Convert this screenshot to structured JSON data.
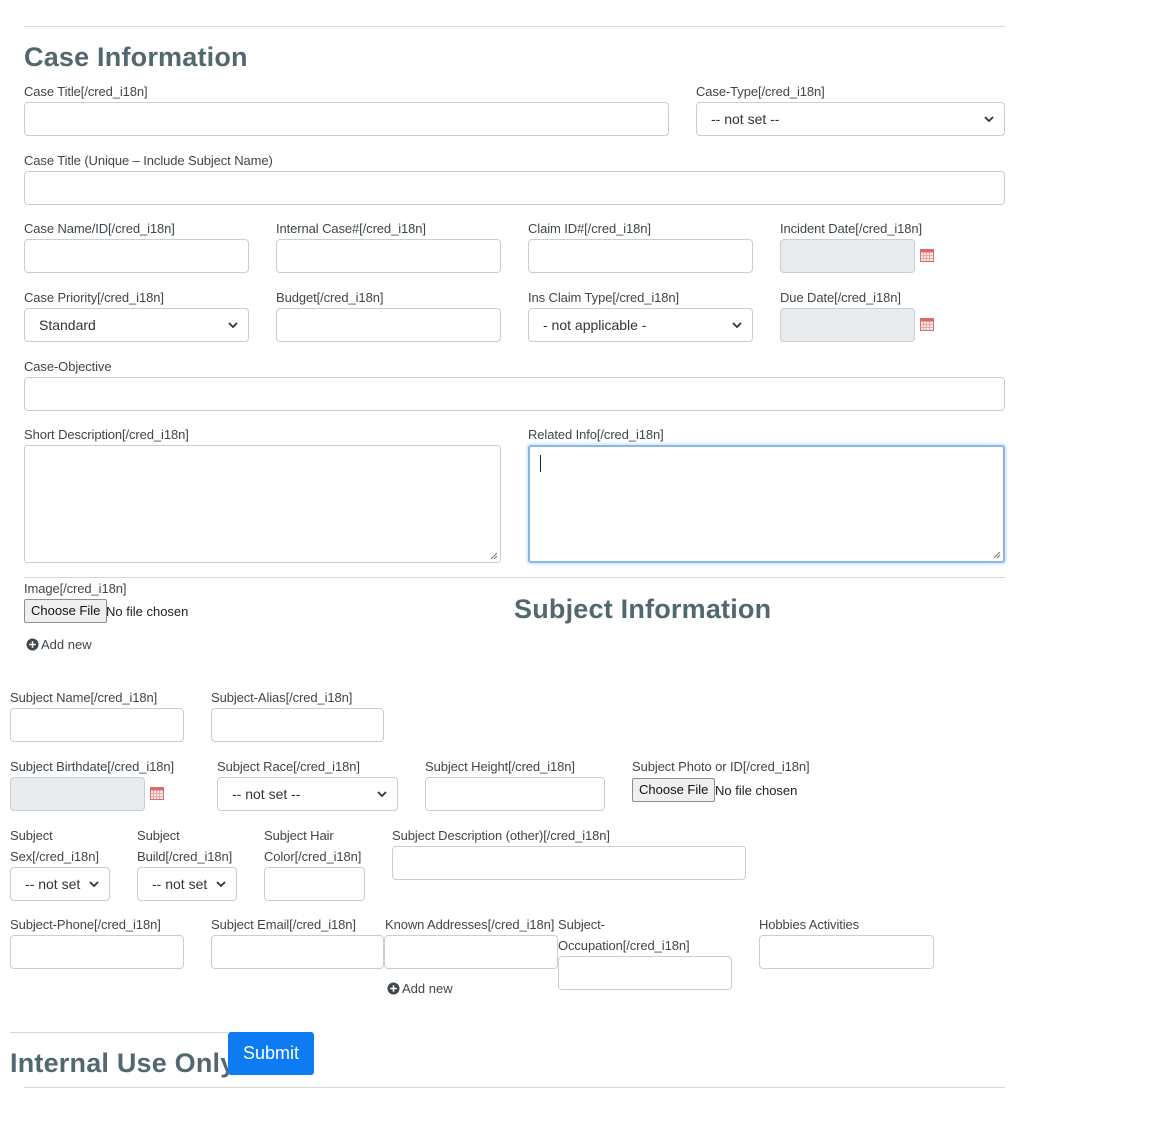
{
  "case_section": {
    "title": "Case Information",
    "case_title_label": "Case Title[/cred_i18n]",
    "case_type_label": "Case-Type[/cred_i18n]",
    "case_type_value": "-- not set --",
    "case_title_unique_label": "Case Title (Unique – Include Subject Name)",
    "case_name_label": "Case Name/ID[/cred_i18n]",
    "internal_case_label": "Internal Case#[/cred_i18n]",
    "claim_id_label": "Claim ID#[/cred_i18n]",
    "incident_date_label": "Incident Date[/cred_i18n]",
    "case_priority_label": "Case Priority[/cred_i18n]",
    "case_priority_value": "Standard",
    "budget_label": "Budget[/cred_i18n]",
    "ins_claim_type_label": "Ins Claim Type[/cred_i18n]",
    "ins_claim_type_value": "- not applicable -",
    "due_date_label": "Due Date[/cred_i18n]",
    "case_objective_label": "Case-Objective",
    "short_description_label": "Short Description[/cred_i18n]",
    "related_info_label": "Related Info[/cred_i18n]",
    "image_label": "Image[/cred_i18n]",
    "choose_file": "Choose File",
    "no_file": "No file chosen",
    "add_new": "Add new"
  },
  "subject_section": {
    "title": "Subject Information",
    "subject_name_label": "Subject Name[/cred_i18n]",
    "subject_alias_label": "Subject-Alias[/cred_i18n]",
    "birthdate_label": "Subject Birthdate[/cred_i18n]",
    "race_label": "Subject Race[/cred_i18n]",
    "race_value": "-- not set --",
    "height_label": "Subject Height[/cred_i18n]",
    "photo_label": "Subject Photo or ID[/cred_i18n]",
    "choose_file": "Choose File",
    "no_file": "No file chosen",
    "sex_label_1": "Subject",
    "sex_label_2": "Sex[/cred_i18n]",
    "sex_value": "-- not set",
    "build_label_1": "Subject",
    "build_label_2": "Build[/cred_i18n]",
    "build_value": "-- not set",
    "hair_label_1": "Subject Hair",
    "hair_label_2": "Color[/cred_i18n]",
    "description_label": "Subject Description (other)[/cred_i18n]",
    "phone_label": "Subject-Phone[/cred_i18n]",
    "email_label": "Subject Email[/cred_i18n]",
    "addresses_label": "Known Addresses[/cred_i18n]",
    "occupation_label_1": "Subject-",
    "occupation_label_2": "Occupation[/cred_i18n]",
    "hobbies_label": "Hobbies Activities",
    "add_new": "Add new"
  },
  "internal_section": {
    "title": "Internal Use Only"
  },
  "submit_label": "Submit",
  "colors": {
    "heading": "#52686f",
    "submit_bg": "#0d7cf2",
    "focus_border": "#87b6e9",
    "disabled_bg": "#e9ecef"
  }
}
